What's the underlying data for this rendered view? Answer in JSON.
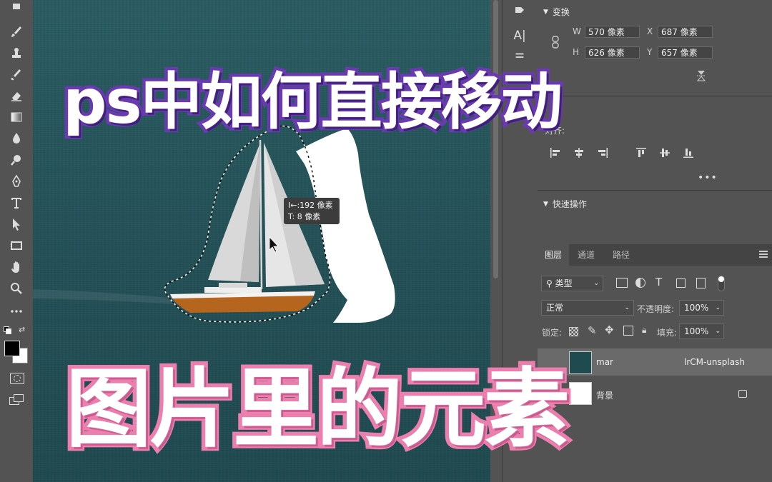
{
  "tools": [
    {
      "name": "eraser-top-icon"
    },
    {
      "name": "brush-icon"
    },
    {
      "name": "stamp-icon"
    },
    {
      "name": "history-brush-icon"
    },
    {
      "name": "eraser-icon"
    },
    {
      "name": "gradient-icon"
    },
    {
      "name": "blur-icon"
    },
    {
      "name": "dodge-icon"
    },
    {
      "name": "pen-icon"
    },
    {
      "name": "type-icon"
    },
    {
      "name": "path-select-icon"
    },
    {
      "name": "rectangle-icon"
    },
    {
      "name": "hand-icon"
    },
    {
      "name": "zoom-icon"
    },
    {
      "name": "more-tools-icon"
    }
  ],
  "overlay": {
    "title_top": "ps中如何直接移动",
    "title_bottom": "图片里的元素"
  },
  "measurement": {
    "dx": "192 像素",
    "dy": "8 像素"
  },
  "transform": {
    "header": "变换",
    "w_label": "W",
    "w_value": "570 像素",
    "x_label": "X",
    "x_value": "687 像素",
    "h_label": "H",
    "h_value": "626 像素",
    "y_label": "Y",
    "y_value": "657 像素"
  },
  "align": {
    "label": "对齐:"
  },
  "quick_actions": {
    "header": "快速操作"
  },
  "layers_panel": {
    "tabs": [
      "图层",
      "通道",
      "路径"
    ],
    "filter_label": "类型",
    "blend_mode": "正常",
    "opacity_label": "不透明度:",
    "opacity_value": "100%",
    "lock_label": "锁定:",
    "fill_label": "填充:",
    "fill_value": "100%",
    "layers": [
      {
        "name": "marc-olivier-jodoin-NqOInJ-ttqM-unsplash",
        "visible_text_left": "mar",
        "visible_text_right": "lrCM-unsplash"
      },
      {
        "name": "背景",
        "visible_text_left": "背景"
      }
    ]
  },
  "colors": {
    "title_top_stroke": "#6a3ab0",
    "title_bottom_stroke": "#ec7fae",
    "sea": "#245258",
    "panel_bg": "#535353"
  }
}
